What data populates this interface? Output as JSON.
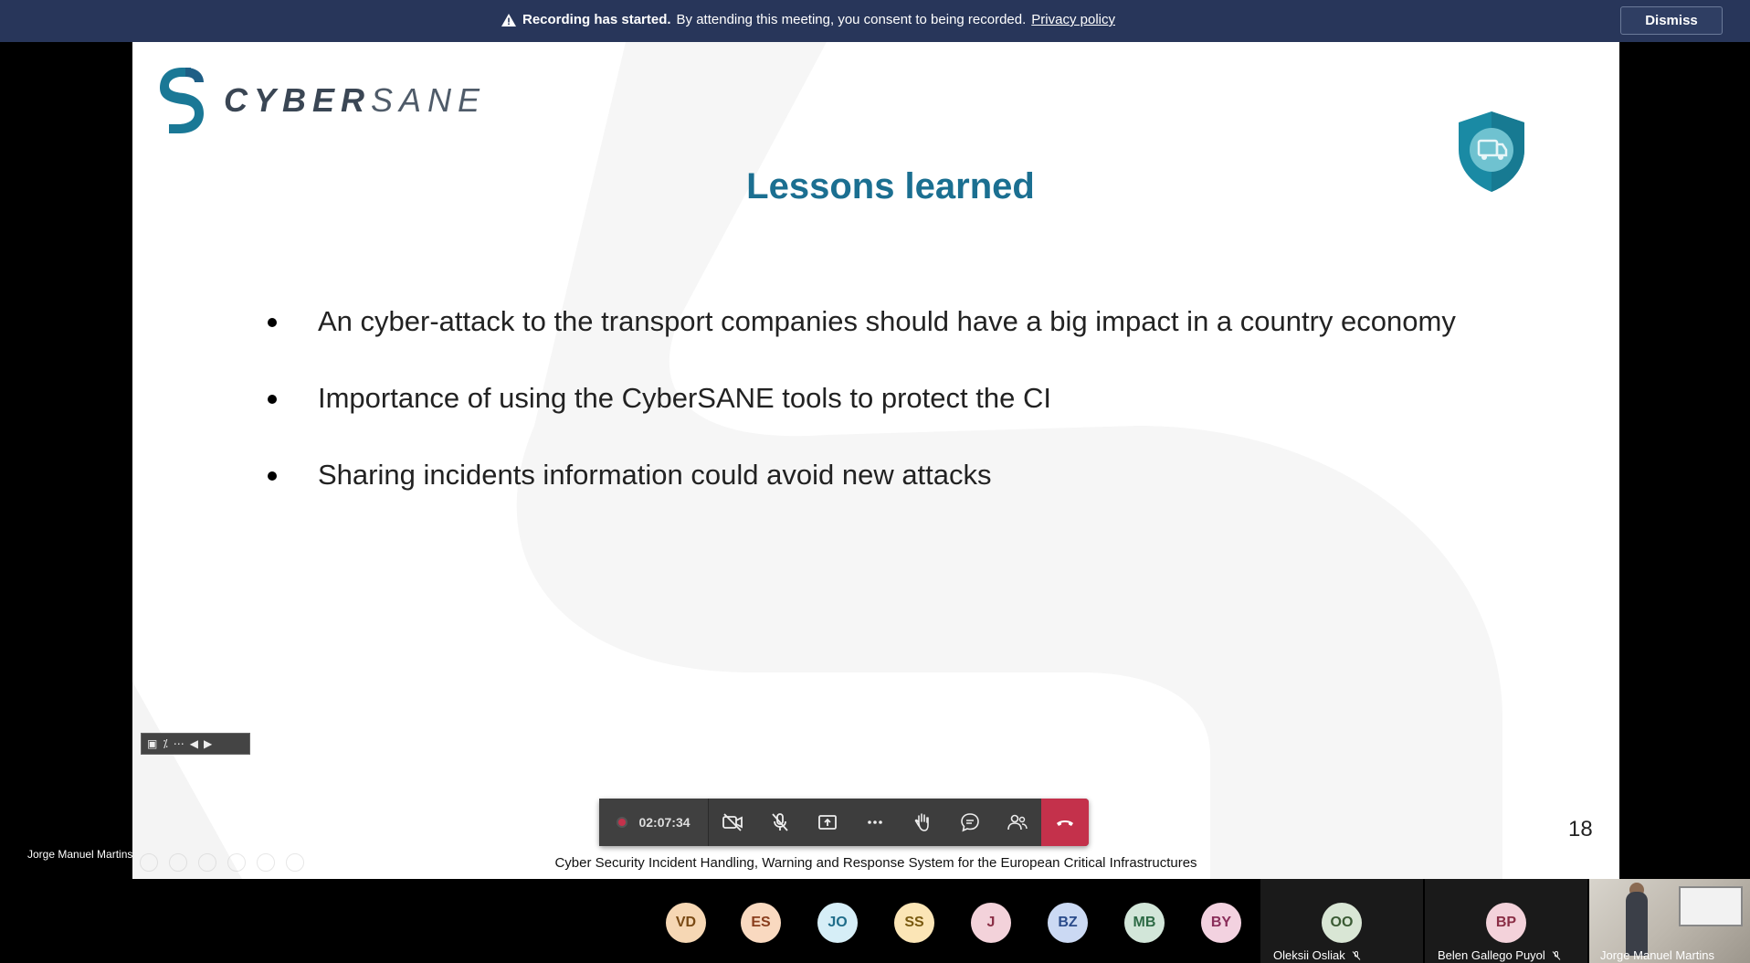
{
  "banner": {
    "bold": "Recording has started.",
    "message": "By attending this meeting, you consent to being recorded.",
    "link": "Privacy policy",
    "dismiss": "Dismiss"
  },
  "slide": {
    "logo": {
      "bold": "CYBER",
      "light": "SANE"
    },
    "title": "Lessons learned",
    "bullets": [
      "An cyber-attack to the transport companies should have a big impact in a country economy",
      "Importance of using the CyberSANE tools to protect the CI",
      "Sharing incidents information could avoid new attacks"
    ],
    "page_number": "18",
    "footer": "Cyber Security Incident Handling, Warning and Response System for the European Critical Infrastructures",
    "accent_color": "#1b6f91"
  },
  "presenter_name": "Jorge Manuel Martins",
  "call": {
    "elapsed": "02:07:34",
    "buttons": [
      "camera-off-icon",
      "mic-off-icon",
      "share-screen-icon",
      "more-icon",
      "raise-hand-icon",
      "chat-icon",
      "participants-icon",
      "hang-up-icon"
    ],
    "hangup_color": "#c4314b"
  },
  "participants": [
    {
      "initials": "VD",
      "bg": "#f6d7b4",
      "fg": "#7a4a14"
    },
    {
      "initials": "ES",
      "bg": "#f9d9c0",
      "fg": "#8a3e1d"
    },
    {
      "initials": "JO",
      "bg": "#d6eef7",
      "fg": "#1f6d8a"
    },
    {
      "initials": "SS",
      "bg": "#fbe5b6",
      "fg": "#7a5a10"
    },
    {
      "initials": "J",
      "bg": "#f3d2da",
      "fg": "#8a2e45"
    },
    {
      "initials": "BZ",
      "bg": "#cbd9f3",
      "fg": "#2a4b8a"
    },
    {
      "initials": "MB",
      "bg": "#d2e6d9",
      "fg": "#2d6a45"
    },
    {
      "initials": "BY",
      "bg": "#f3d2e0",
      "fg": "#8a2e5a"
    }
  ],
  "named_participants": [
    {
      "initials": "OO",
      "name": "Oleksii Osliak",
      "bg": "#d9e6d5",
      "fg": "#3a5a33"
    },
    {
      "initials": "BP",
      "name": "Belen Gallego Puyol",
      "bg": "#f3d2da",
      "fg": "#8a2e45"
    }
  ],
  "video_participant": {
    "name": "Jorge Manuel Martins"
  }
}
